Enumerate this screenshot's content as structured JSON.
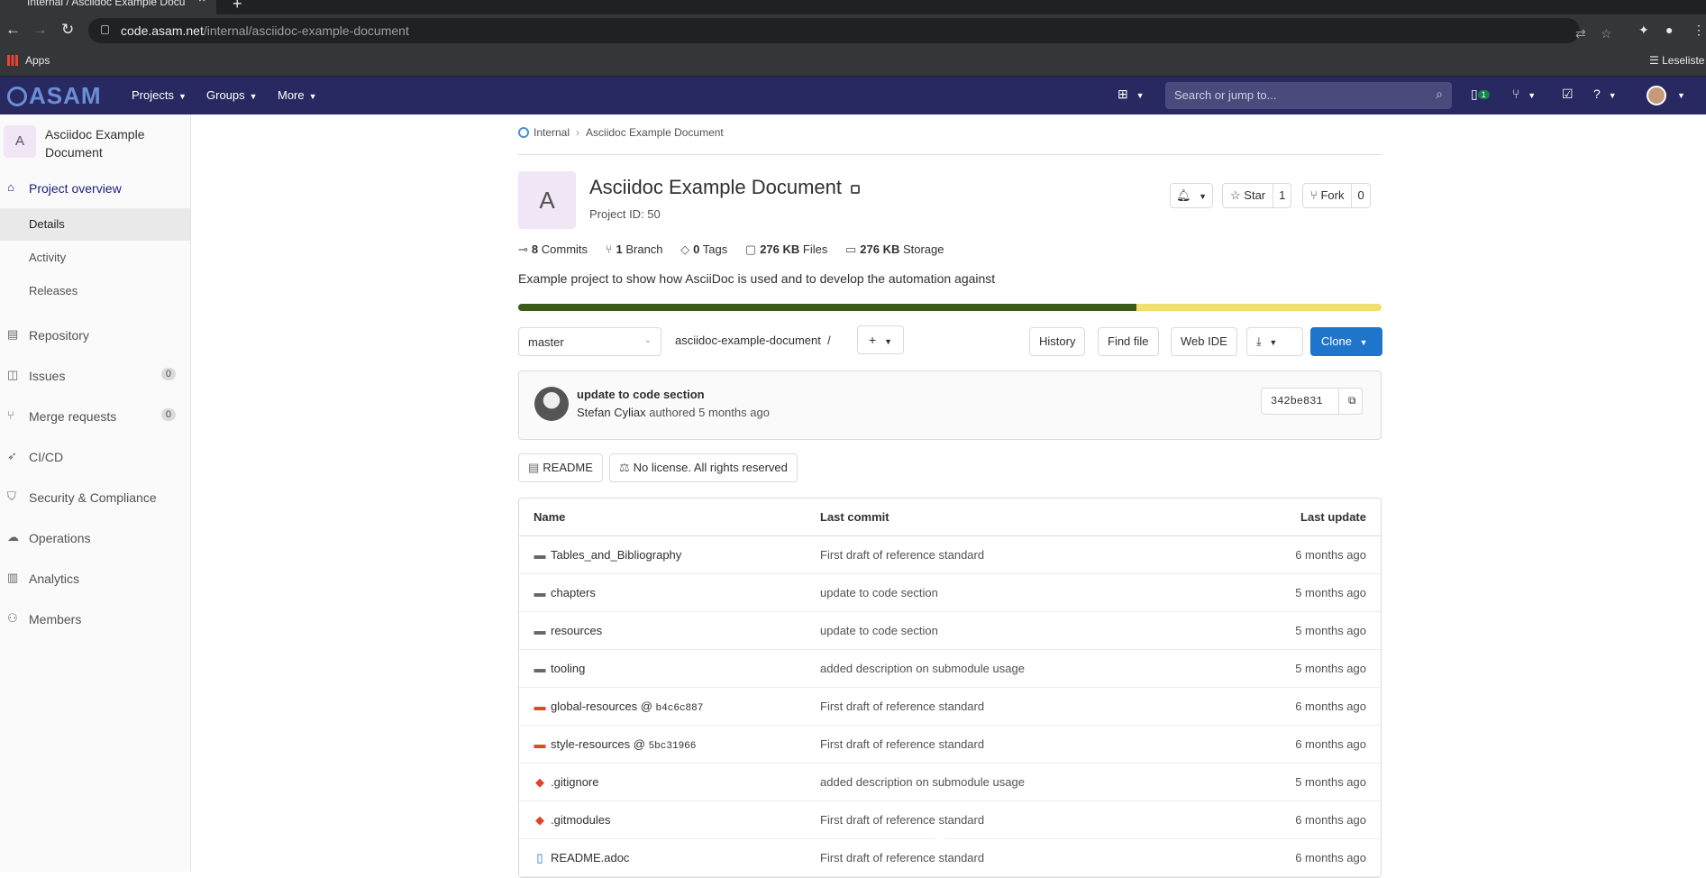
{
  "browser": {
    "tab_title": "Internal / Asciidoc Example Docu",
    "url_host": "code.asam.net",
    "url_path": "/internal/asciidoc-example-document",
    "bookmarks": {
      "apps": "Apps",
      "reading_list": "Leseliste"
    }
  },
  "gitlab_nav": {
    "logo": "ASAM",
    "projects": "Projects",
    "groups": "Groups",
    "more": "More",
    "search_placeholder": "Search or jump to...",
    "issues_count": "1"
  },
  "sidebar": {
    "project_avatar": "A",
    "project_name": "Asciidoc Example Document",
    "items": [
      {
        "label": "Project overview",
        "icon": "home-icon"
      },
      {
        "label": "Details"
      },
      {
        "label": "Activity"
      },
      {
        "label": "Releases"
      },
      {
        "label": "Repository",
        "icon": "doc-icon"
      },
      {
        "label": "Issues",
        "icon": "issues-icon",
        "count": "0"
      },
      {
        "label": "Merge requests",
        "icon": "merge-icon",
        "count": "0"
      },
      {
        "label": "CI/CD",
        "icon": "rocket-icon"
      },
      {
        "label": "Security & Compliance",
        "icon": "shield-icon"
      },
      {
        "label": "Operations",
        "icon": "cloud-icon"
      },
      {
        "label": "Analytics",
        "icon": "chart-icon"
      },
      {
        "label": "Members",
        "icon": "users-icon"
      }
    ]
  },
  "breadcrumb": {
    "group": "Internal",
    "project": "Asciidoc Example Document"
  },
  "project": {
    "avatar": "A",
    "title": "Asciidoc Example Document",
    "id_label": "Project ID: 50",
    "star_label": "Star",
    "star_count": "1",
    "fork_label": "Fork",
    "fork_count": "0",
    "stats": {
      "commits_n": "8",
      "commits": "Commits",
      "branch_n": "1",
      "branch": "Branch",
      "tags_n": "0",
      "tags": "Tags",
      "files_n": "276 KB",
      "files": "Files",
      "storage_n": "276 KB",
      "storage": "Storage"
    },
    "description": "Example project to show how AsciiDoc is used and to develop the automation against",
    "languages": [
      {
        "share": 0.716,
        "color": "#3c5a1a"
      },
      {
        "share": 0.284,
        "color": "#f0e06a"
      }
    ]
  },
  "toolbar": {
    "branch": "master",
    "repo_path": "asciidoc-example-document",
    "path_sep": "/",
    "history": "History",
    "find_file": "Find file",
    "web_ide": "Web IDE",
    "clone": "Clone"
  },
  "last_commit": {
    "message": "update to code section",
    "author": "Stefan Cyliax",
    "authored": "authored 5 months ago",
    "sha": "342be831"
  },
  "pills": {
    "readme": "README",
    "license": "No license. All rights reserved"
  },
  "tree": {
    "headers": {
      "name": "Name",
      "last_commit": "Last commit",
      "last_update": "Last update"
    },
    "rows": [
      {
        "name": "Tables_and_Bibliography",
        "type": "folder",
        "commit": "First draft of reference standard",
        "updated": "6 months ago"
      },
      {
        "name": "chapters",
        "type": "folder",
        "commit": "update to code section",
        "updated": "5 months ago"
      },
      {
        "name": "resources",
        "type": "folder",
        "commit": "update to code section",
        "updated": "5 months ago"
      },
      {
        "name": "tooling",
        "type": "folder",
        "commit": "added description on submodule usage",
        "updated": "5 months ago"
      },
      {
        "name": "global-resources @",
        "sha": "b4c6c887",
        "type": "submodule",
        "commit": "First draft of reference standard",
        "updated": "6 months ago"
      },
      {
        "name": "style-resources @",
        "sha": "5bc31966",
        "type": "submodule",
        "commit": "First draft of reference standard",
        "updated": "6 months ago"
      },
      {
        "name": ".gitignore",
        "type": "git",
        "commit": "added description on submodule usage",
        "updated": "5 months ago"
      },
      {
        "name": ".gitmodules",
        "type": "git",
        "commit": "First draft of reference standard",
        "updated": "6 months ago"
      },
      {
        "name": "README.adoc",
        "type": "doc",
        "commit": "First draft of reference standard",
        "updated": "6 months ago"
      }
    ]
  }
}
